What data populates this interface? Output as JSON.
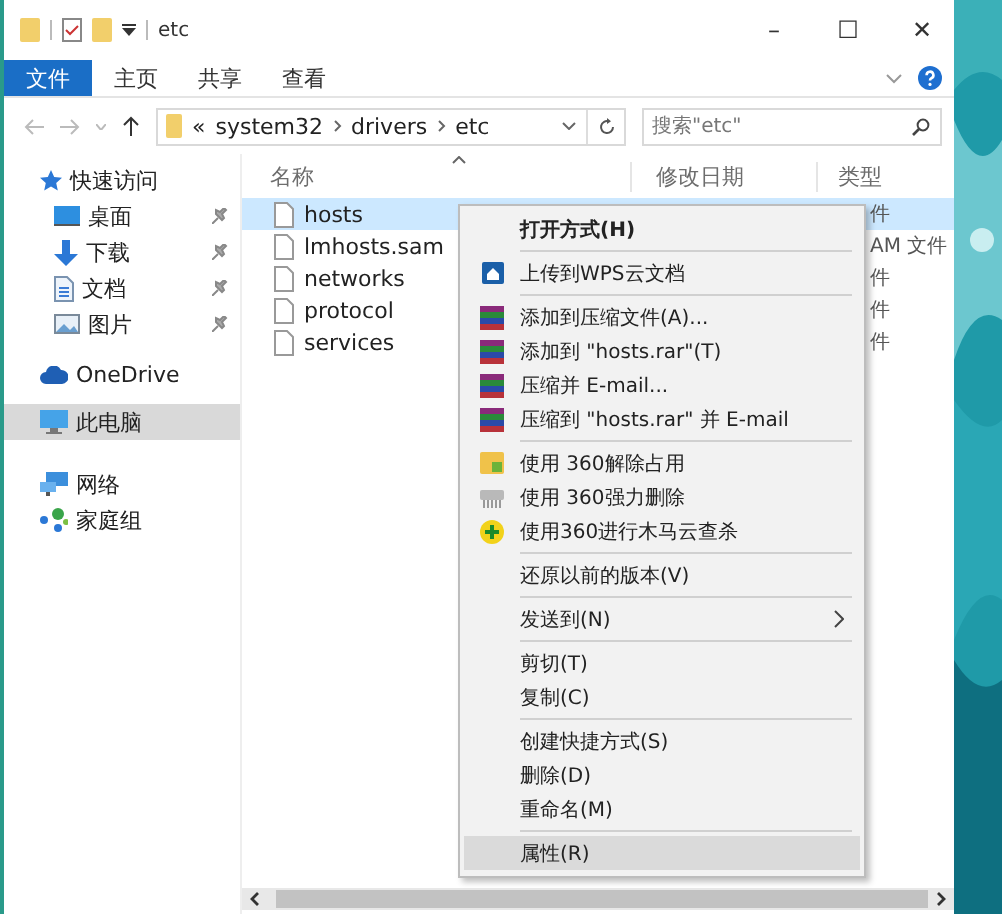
{
  "window": {
    "title": "etc",
    "controls": [
      "–",
      "☐",
      "✕"
    ]
  },
  "ribbon": {
    "tabs": [
      {
        "label": "文件",
        "selected": true
      },
      {
        "label": "主页",
        "selected": false
      },
      {
        "label": "共享",
        "selected": false
      },
      {
        "label": "查看",
        "selected": false
      }
    ]
  },
  "address_bar": {
    "prefix": "«",
    "segments": [
      "system32",
      "drivers",
      "etc"
    ]
  },
  "search": {
    "placeholder": "搜索\"etc\""
  },
  "sidebar": {
    "items": [
      {
        "label": "快速访问",
        "kind": "star",
        "pinned": false,
        "selected": false
      },
      {
        "label": "桌面",
        "kind": "desktop",
        "pinned": true,
        "selected": false
      },
      {
        "label": "下载",
        "kind": "download",
        "pinned": true,
        "selected": false
      },
      {
        "label": "文档",
        "kind": "document",
        "pinned": true,
        "selected": false
      },
      {
        "label": "图片",
        "kind": "pictures",
        "pinned": true,
        "selected": false
      },
      {
        "label": "OneDrive",
        "kind": "cloud",
        "pinned": false,
        "selected": false
      },
      {
        "label": "此电脑",
        "kind": "computer",
        "pinned": false,
        "selected": true
      },
      {
        "label": "网络",
        "kind": "network",
        "pinned": false,
        "selected": false
      },
      {
        "label": "家庭组",
        "kind": "homegroup",
        "pinned": false,
        "selected": false
      }
    ]
  },
  "file_list": {
    "columns": [
      "名称",
      "修改日期",
      "类型"
    ],
    "rows": [
      {
        "name": "hosts",
        "type": "件",
        "selected": true
      },
      {
        "name": "lmhosts.sam",
        "type": "AM 文件",
        "selected": false
      },
      {
        "name": "networks",
        "type": "件",
        "selected": false
      },
      {
        "name": "protocol",
        "type": "件",
        "selected": false
      },
      {
        "name": "services",
        "type": "件",
        "selected": false
      }
    ]
  },
  "context_menu": {
    "groups": [
      [
        {
          "label": "打开方式(H)",
          "kind": "plain",
          "bold": true,
          "submenu": false,
          "hovered": false
        }
      ],
      [
        {
          "label": "上传到WPS云文档",
          "kind": "upload",
          "bold": false,
          "submenu": false,
          "hovered": false
        }
      ],
      [
        {
          "label": "添加到压缩文件(A)...",
          "kind": "archive",
          "bold": false,
          "submenu": false,
          "hovered": false
        },
        {
          "label": "添加到 \"hosts.rar\"(T)",
          "kind": "archive",
          "bold": false,
          "submenu": false,
          "hovered": false
        },
        {
          "label": "压缩并 E-mail...",
          "kind": "archive",
          "bold": false,
          "submenu": false,
          "hovered": false
        },
        {
          "label": "压缩到 \"hosts.rar\" 并 E-mail",
          "kind": "archive",
          "bold": false,
          "submenu": false,
          "hovered": false
        }
      ],
      [
        {
          "label": "使用 360解除占用",
          "kind": "unlock",
          "bold": false,
          "submenu": false,
          "hovered": false
        },
        {
          "label": "使用 360强力删除",
          "kind": "shred",
          "bold": false,
          "submenu": false,
          "hovered": false
        },
        {
          "label": "使用360进行木马云查杀",
          "kind": "scan",
          "bold": false,
          "submenu": false,
          "hovered": false
        }
      ],
      [
        {
          "label": "还原以前的版本(V)",
          "kind": "plain",
          "bold": false,
          "submenu": false,
          "hovered": false
        }
      ],
      [
        {
          "label": "发送到(N)",
          "kind": "plain",
          "bold": false,
          "submenu": true,
          "hovered": false
        }
      ],
      [
        {
          "label": "剪切(T)",
          "kind": "plain",
          "bold": false,
          "submenu": false,
          "hovered": false
        },
        {
          "label": "复制(C)",
          "kind": "plain",
          "bold": false,
          "submenu": false,
          "hovered": false
        }
      ],
      [
        {
          "label": "创建快捷方式(S)",
          "kind": "plain",
          "bold": false,
          "submenu": false,
          "hovered": false
        },
        {
          "label": "删除(D)",
          "kind": "plain",
          "bold": false,
          "submenu": false,
          "hovered": false
        },
        {
          "label": "重命名(M)",
          "kind": "plain",
          "bold": false,
          "submenu": false,
          "hovered": false
        }
      ],
      [
        {
          "label": "属性(R)",
          "kind": "plain",
          "bold": false,
          "submenu": false,
          "hovered": true
        }
      ]
    ]
  }
}
